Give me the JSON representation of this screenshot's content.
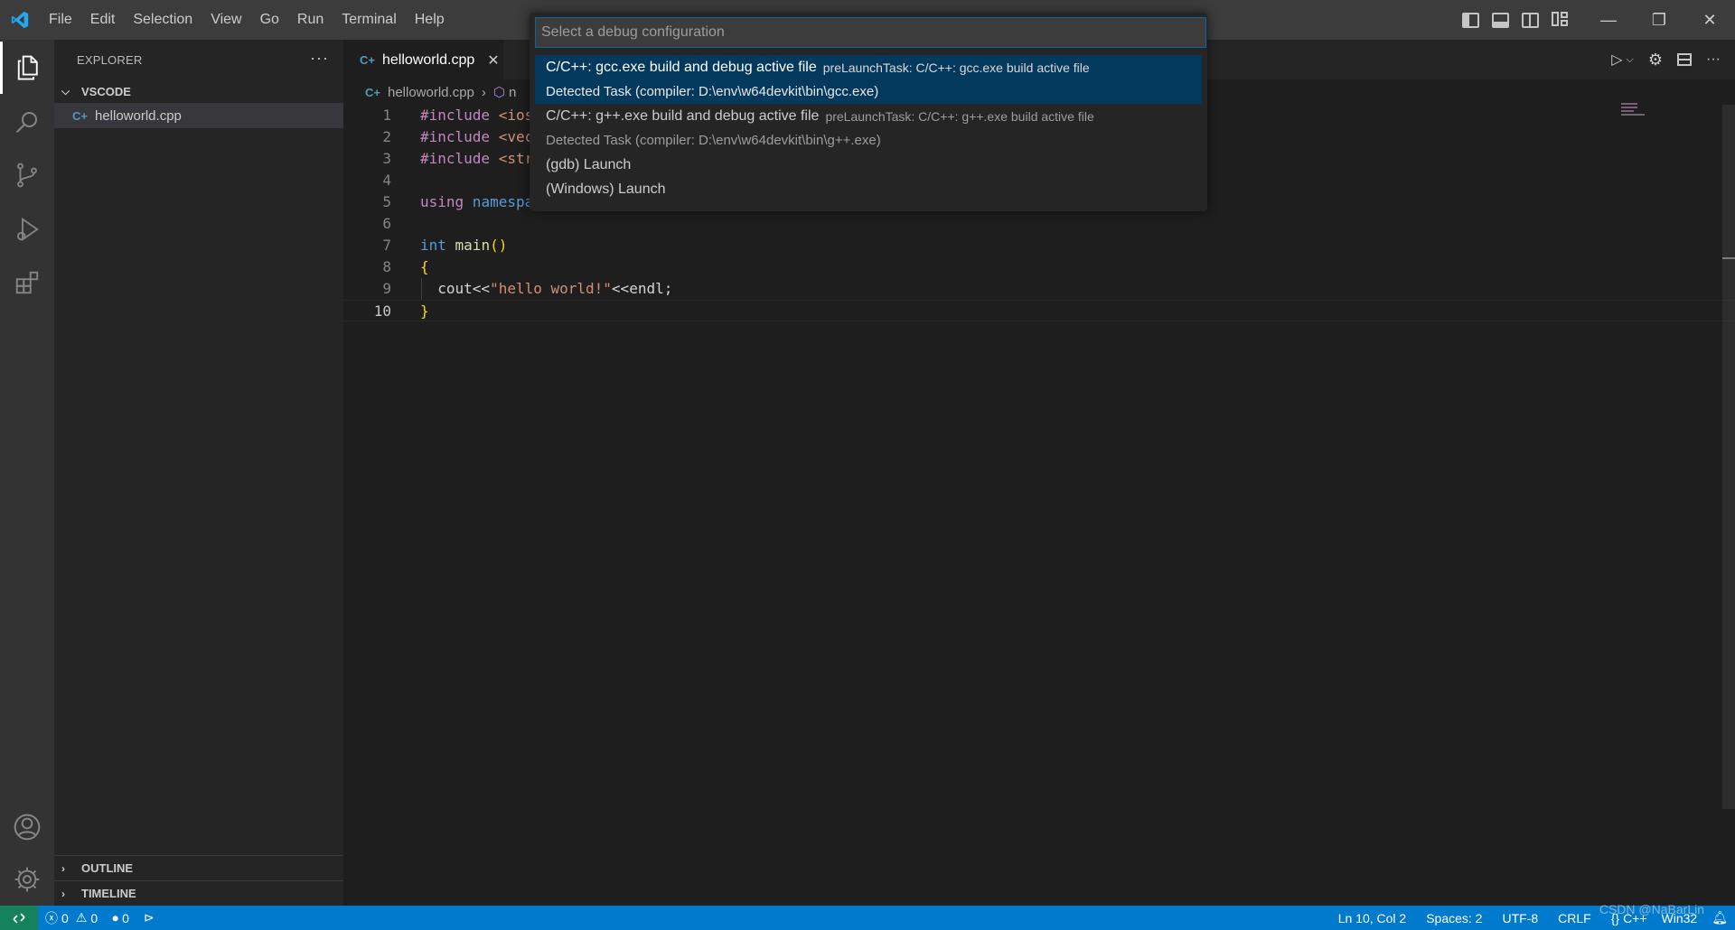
{
  "menu": [
    "File",
    "Edit",
    "Selection",
    "View",
    "Go",
    "Run",
    "Terminal",
    "Help"
  ],
  "sidebar": {
    "title": "EXPLORER",
    "more": "···",
    "folder": "VSCODE",
    "files": [
      "helloworld.cpp"
    ],
    "outline": "OUTLINE",
    "timeline": "TIMELINE"
  },
  "editor": {
    "tab_label": "helloworld.cpp",
    "tab_close": "✕",
    "breadcrumb_file": "helloworld.cpp",
    "breadcrumb_next": "n",
    "line_numbers": [
      "1",
      "2",
      "3",
      "4",
      "5",
      "6",
      "7",
      "8",
      "9",
      "10"
    ],
    "code": {
      "l1_pre": "#include",
      "l1_inc": " <ios",
      "l2_pre": "#include",
      "l2_inc": " <vec",
      "l3_pre": "#include",
      "l3_inc": " <str",
      "l5_kw": "using",
      "l5_ns": " namespa",
      "l7_kw": "int",
      "l7_fn": " main",
      "l7_paren": "()",
      "l8": "{",
      "l9_a": "cout<<",
      "l9_str": "\"hello world!\"",
      "l9_b": "<<endl;",
      "l10": "}"
    }
  },
  "quickpick": {
    "placeholder": "Select a debug configuration",
    "items": [
      {
        "label": "C/C++: gcc.exe build and debug active file",
        "description": "preLaunchTask: C/C++: gcc.exe build active file",
        "detail": "Detected Task (compiler: D:\\env\\w64devkit\\bin\\gcc.exe)"
      },
      {
        "label": "C/C++: g++.exe build and debug active file",
        "description": "preLaunchTask: C/C++: g++.exe build active file",
        "detail": "Detected Task (compiler: D:\\env\\w64devkit\\bin\\g++.exe)"
      },
      {
        "label": "(gdb) Launch"
      },
      {
        "label": "(Windows) Launch"
      }
    ]
  },
  "statusbar": {
    "errors": "0",
    "warnings": "0",
    "ports": "0",
    "position": "Ln 10, Col 2",
    "spaces": "Spaces: 2",
    "encoding": "UTF-8",
    "eol": "CRLF",
    "language": "C++",
    "platform": "Win32",
    "watermark": "CSDN @NaBarLin"
  },
  "colors": {
    "accent": "#007acc",
    "selection": "#04395e",
    "remote": "#16825d"
  }
}
